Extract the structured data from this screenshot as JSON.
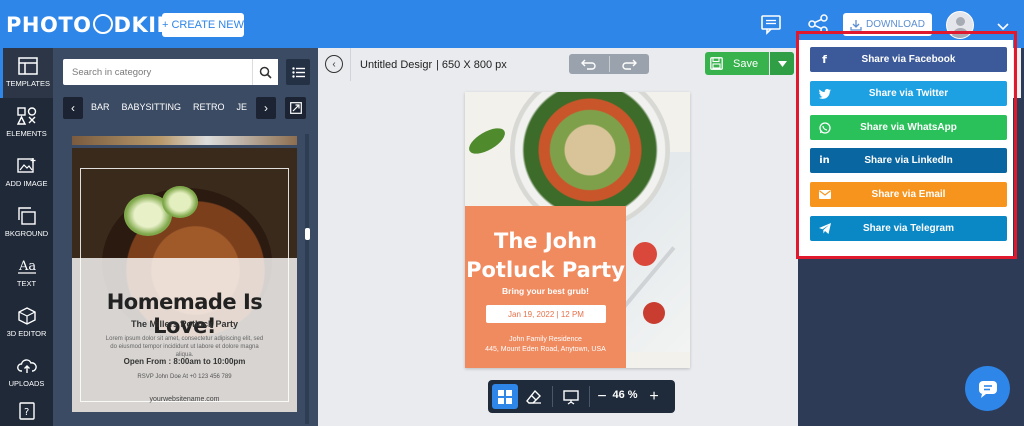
{
  "header": {
    "logo_left": "PHOTO",
    "logo_mid": "D",
    "logo_right": "KING",
    "create_label": "CREATE NEW",
    "download_label": "DOWNLOAD",
    "icons": [
      "message-icon",
      "share-icon",
      "download-icon",
      "avatar",
      "chevron-down-icon"
    ]
  },
  "rail": {
    "items": [
      {
        "label": "TEMPLATES",
        "icon": "templates-icon"
      },
      {
        "label": "ELEMENTS",
        "icon": "elements-icon"
      },
      {
        "label": "ADD IMAGE",
        "icon": "image-icon"
      },
      {
        "label": "BKGROUND",
        "icon": "background-icon"
      },
      {
        "label": "TEXT",
        "icon": "text-icon"
      },
      {
        "label": "3D EDITOR",
        "icon": "cube-icon"
      },
      {
        "label": "UPLOADS",
        "icon": "upload-icon"
      }
    ]
  },
  "panel": {
    "search_placeholder": "Search in category",
    "categories": [
      "BAR",
      "BABYSITTING",
      "RETRO",
      "JE"
    ]
  },
  "thumb": {
    "title": "Homemade Is Love!",
    "subtitle": "The Millers Potluck Party",
    "description": "Lorem ipsum dolor sit amet, consectetur adipiscing elit, sed do eiusmod tempor incididunt ut labore et dolore magna aliqua.",
    "open": "Open From : 8:00am to 10:00pm",
    "rsvp": "RSVP John Doe At +0 123 456 789",
    "website": "yourwebsitename.com"
  },
  "editor": {
    "doc_name": "Untitled Desigr",
    "doc_size": "| 650 X 800 px",
    "save_label": "Save",
    "zoom": "46 %"
  },
  "poster": {
    "title_line1": "The John",
    "title_line2": "Potluck Party",
    "tagline": "Bring your best grub!",
    "date": "Jan 19, 2022 | 12 PM",
    "venue_line1": "John Family Residence",
    "venue_line2": "445, Mount Eden Road, Anytown, USA"
  },
  "share": {
    "items": [
      {
        "label": "Share via Facebook",
        "icon": "facebook-icon",
        "color": "#3c5a99"
      },
      {
        "label": "Share via Twitter",
        "icon": "twitter-icon",
        "color": "#1da1e2"
      },
      {
        "label": "Share via WhatsApp",
        "icon": "whatsapp-icon",
        "color": "#2ac05a"
      },
      {
        "label": "Share via LinkedIn",
        "icon": "linkedin-icon",
        "color": "#0a66a0"
      },
      {
        "label": "Share via Email",
        "icon": "email-icon",
        "color": "#f7941d"
      },
      {
        "label": "Share via Telegram",
        "icon": "telegram-icon",
        "color": "#0a88c6"
      }
    ]
  },
  "colors": {
    "accent": "#2e86e9",
    "highlight": "#e0192e",
    "save": "#37b24d"
  }
}
